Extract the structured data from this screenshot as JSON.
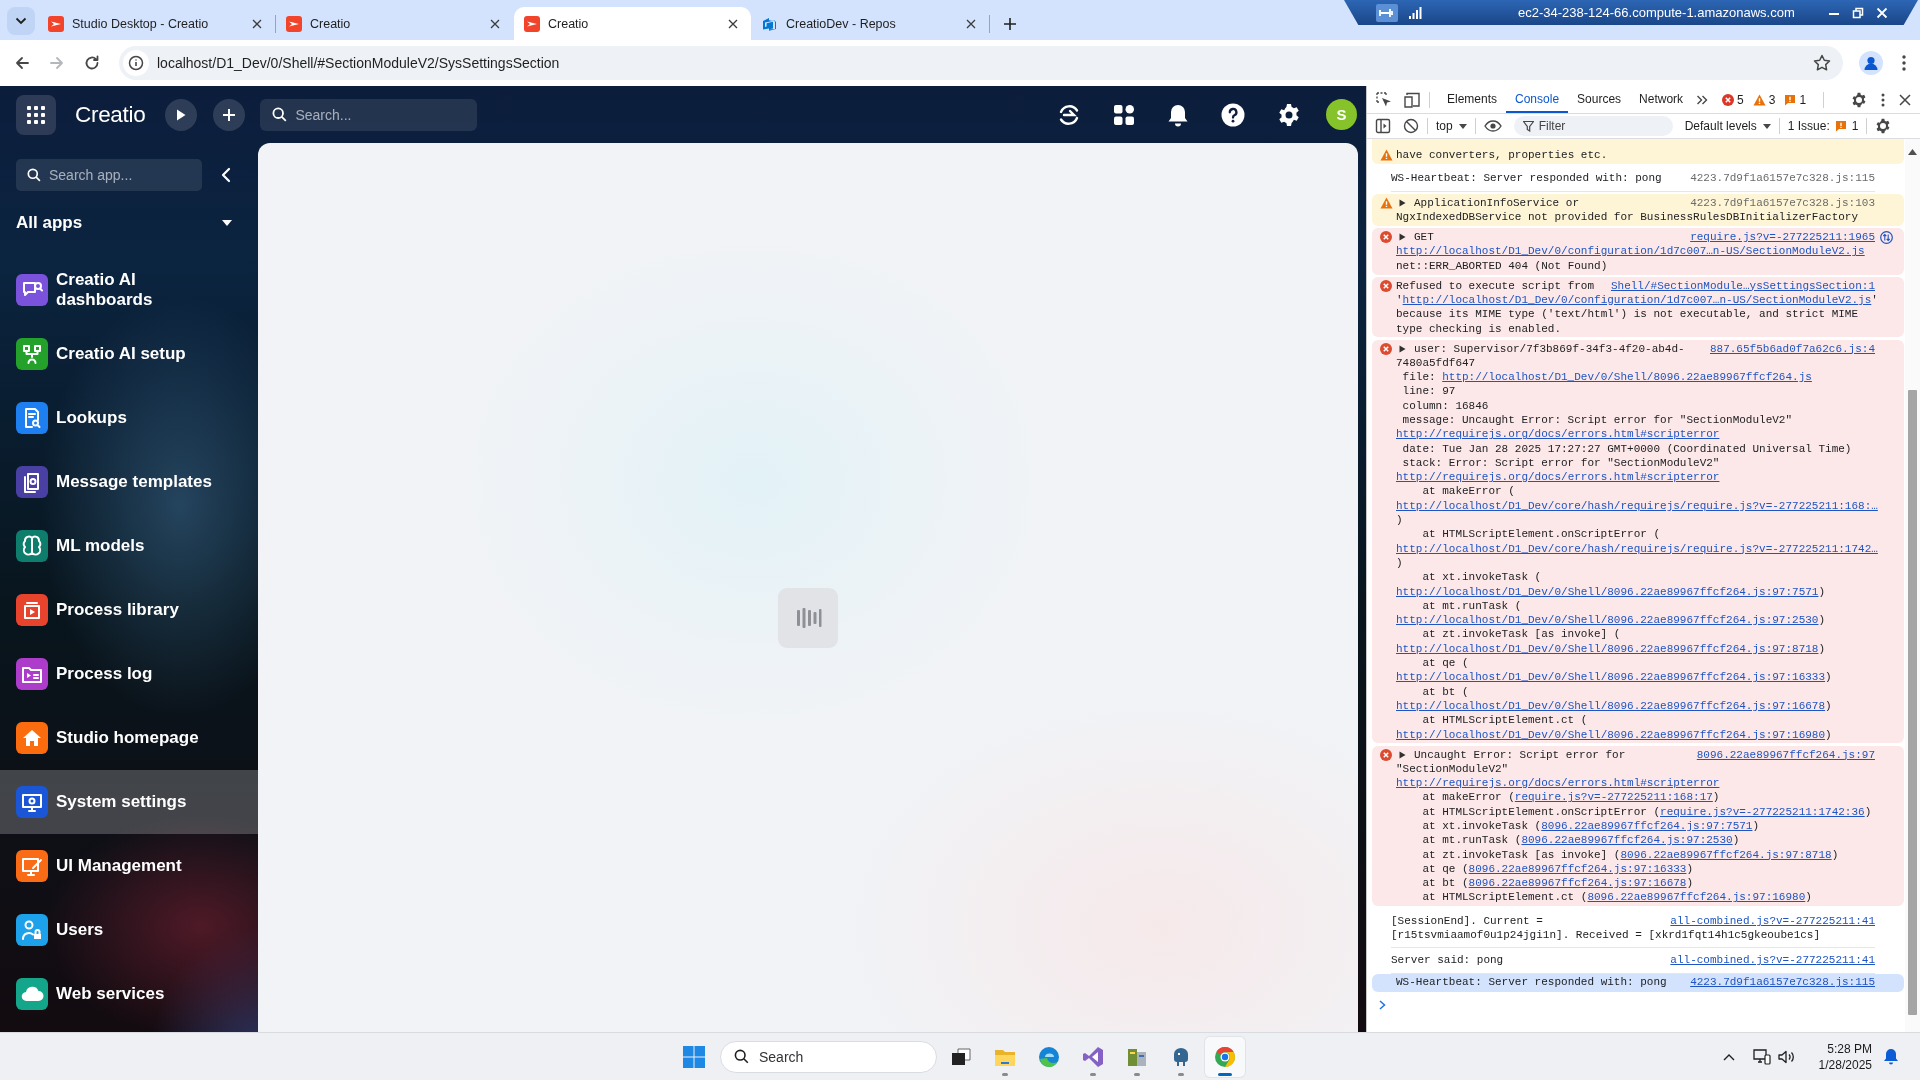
{
  "browser": {
    "tabs": [
      {
        "title": "Studio Desktop - Creatio",
        "kind": "creatio",
        "selected": false
      },
      {
        "title": "Creatio",
        "kind": "creatio",
        "selected": false
      },
      {
        "title": "Creatio",
        "kind": "creatio",
        "selected": true
      },
      {
        "title": "CreatioDev - Repos",
        "kind": "devops",
        "selected": false
      }
    ],
    "nav_buttons": [
      {
        "kind": "back",
        "disabled": false
      },
      {
        "kind": "forward",
        "disabled": true
      },
      {
        "kind": "reload",
        "disabled": false
      }
    ],
    "url": "localhost/D1_Dev/0/Shell/#SectionModuleV2/SysSettingsSection"
  },
  "remote_session": {
    "title": "ec2-34-238-124-66.compute-1.amazonaws.com"
  },
  "creatio": {
    "header": {
      "logo": "Creatio",
      "search_placeholder": "Search...",
      "avatar_initial": "S"
    },
    "sidebar": {
      "search_placeholder": "Search app...",
      "group": "All apps",
      "items": [
        {
          "label": "Creatio AI dashboards",
          "color": "#7b52db",
          "selected": false
        },
        {
          "label": "Creatio AI setup",
          "color": "#24a12a",
          "selected": false
        },
        {
          "label": "Lookups",
          "color": "#1d7ff0",
          "selected": false
        },
        {
          "label": "Message templates",
          "color": "#4a3fa3",
          "selected": false
        },
        {
          "label": "ML models",
          "color": "#0f7d6c",
          "selected": false
        },
        {
          "label": "Process library",
          "color": "#e8432d",
          "selected": false
        },
        {
          "label": "Process log",
          "color": "#ad3ccb",
          "selected": false
        },
        {
          "label": "Studio homepage",
          "color": "#fb6c0e",
          "selected": false
        },
        {
          "label": "System settings",
          "color": "#1a56d6",
          "selected": true
        },
        {
          "label": "UI Management",
          "color": "#f96b14",
          "selected": false
        },
        {
          "label": "Users",
          "color": "#1da1ea",
          "selected": false
        },
        {
          "label": "Web services",
          "color": "#14a68a",
          "selected": false
        }
      ]
    }
  },
  "devtools": {
    "tabs": [
      {
        "label": "Elements",
        "selected": false
      },
      {
        "label": "Console",
        "selected": true
      },
      {
        "label": "Sources",
        "selected": false
      },
      {
        "label": "Network",
        "selected": false
      }
    ],
    "counts": [
      {
        "kind": "error",
        "text": "5"
      },
      {
        "kind": "warning",
        "text": "3"
      },
      {
        "kind": "issue",
        "text": "1"
      }
    ],
    "context": "top",
    "filter_placeholder": "Filter",
    "levels": "Default levels",
    "issues": {
      "label": "1 Issue:",
      "count": "1"
    },
    "messages": [
      {
        "kind": "warning",
        "selected": false,
        "lines": [
          {
            "kind": "plain",
            "segments": [
              {
                "text": "have converters, properties etc.",
                "link": false
              }
            ]
          }
        ]
      },
      {
        "kind": "info",
        "selected": false,
        "source": {
          "text": "4223.7d9f1a6157e7c328.js:115",
          "link": false
        },
        "lines": [
          {
            "kind": "plain",
            "segments": [
              {
                "text": "WS-Heartbeat: Server responded with: pong",
                "link": false
              }
            ]
          }
        ]
      },
      {
        "kind": "warning",
        "selected": false,
        "expanded": false,
        "source": {
          "text": "4223.7d9f1a6157e7c328.js:103",
          "link": false
        },
        "lines": [
          {
            "kind": "plain",
            "segments": [
              {
                "text": "ApplicationInfoService or",
                "link": false
              }
            ]
          },
          {
            "kind": "plain",
            "segments": [
              {
                "text": "NgxIndexedDBService not provided for BusinessRulesDBInitializerFactory",
                "link": false
              }
            ]
          }
        ]
      },
      {
        "kind": "error",
        "selected": false,
        "expanded": false,
        "network_request": true,
        "source": {
          "text": "require.js?v=-277225211:1965",
          "link": true
        },
        "lines": [
          {
            "kind": "plain",
            "segments": [
              {
                "text": "GET",
                "link": false
              }
            ]
          },
          {
            "kind": "plain",
            "segments": [
              {
                "text": "http://localhost/D1_Dev/0/configuration/1d7c007…n-US/SectionModuleV2.js",
                "link": true
              }
            ]
          },
          {
            "kind": "plain",
            "segments": [
              {
                "text": "net::ERR_ABORTED 404 (Not Found)",
                "link": false
              }
            ]
          }
        ]
      },
      {
        "kind": "error",
        "selected": false,
        "source": {
          "text": "Shell/#SectionModule…ysSettingsSection:1",
          "link": true
        },
        "lines": [
          {
            "kind": "plain",
            "segments": [
              {
                "text": "Refused to execute script from",
                "link": false
              }
            ]
          },
          {
            "kind": "plain",
            "segments": [
              {
                "text": "'",
                "link": false
              },
              {
                "text": "http://localhost/D1_Dev/0/configuration/1d7c007…n-US/SectionModuleV2.js",
                "link": true
              },
              {
                "text": "'",
                "link": false
              }
            ]
          },
          {
            "kind": "plain",
            "segments": [
              {
                "text": "because its MIME type ('text/html') is not executable, and strict MIME",
                "link": false
              }
            ]
          },
          {
            "kind": "plain",
            "segments": [
              {
                "text": "type checking is enabled.",
                "link": false
              }
            ]
          }
        ]
      },
      {
        "kind": "error",
        "selected": false,
        "expanded": false,
        "source": {
          "text": "887.65f5b6ad0f7a62c6.js:4",
          "link": true
        },
        "lines": [
          {
            "kind": "plain",
            "segments": [
              {
                "text": "user: Supervisor/7f3b869f-34f3-4f20-ab4d-",
                "link": false
              }
            ]
          },
          {
            "kind": "plain",
            "segments": [
              {
                "text": "7480a5fdf647",
                "link": false
              }
            ]
          },
          {
            "kind": "prop",
            "segments": [
              {
                "text": "file: ",
                "link": false
              },
              {
                "text": "http://localhost/D1_Dev/0/Shell/8096.22ae89967ffcf264.js",
                "link": true
              }
            ]
          },
          {
            "kind": "prop",
            "segments": [
              {
                "text": "line: 97",
                "link": false
              }
            ]
          },
          {
            "kind": "prop",
            "segments": [
              {
                "text": "column: 16846",
                "link": false
              }
            ]
          },
          {
            "kind": "prop",
            "segments": [
              {
                "text": "message: Uncaught Error: Script error for \"SectionModuleV2\"",
                "link": false
              }
            ]
          },
          {
            "kind": "plain",
            "segments": [
              {
                "text": "http://requirejs.org/docs/errors.html#scripterror",
                "link": true
              }
            ]
          },
          {
            "kind": "prop",
            "segments": [
              {
                "text": "date: Tue Jan 28 2025 17:27:27 GMT+0000 (Coordinated Universal Time)",
                "link": false
              }
            ]
          },
          {
            "kind": "prop",
            "segments": [
              {
                "text": "stack: Error: Script error for \"SectionModuleV2\"",
                "link": false
              }
            ]
          },
          {
            "kind": "plain",
            "segments": [
              {
                "text": "http://requirejs.org/docs/errors.html#scripterror",
                "link": true
              }
            ]
          },
          {
            "kind": "stack",
            "segments": [
              {
                "text": "at makeError (",
                "link": false
              }
            ]
          },
          {
            "kind": "plain",
            "segments": [
              {
                "text": "http://localhost/D1_Dev/core/hash/requirejs/require.js?v=-277225211:168:…",
                "link": true
              }
            ]
          },
          {
            "kind": "plain",
            "segments": [
              {
                "text": ")",
                "link": false
              }
            ]
          },
          {
            "kind": "stack",
            "segments": [
              {
                "text": "at HTMLScriptElement.onScriptError (",
                "link": false
              }
            ]
          },
          {
            "kind": "plain",
            "segments": [
              {
                "text": "http://localhost/D1_Dev/core/hash/requirejs/require.js?v=-277225211:1742…",
                "link": true
              }
            ]
          },
          {
            "kind": "plain",
            "segments": [
              {
                "text": ")",
                "link": false
              }
            ]
          },
          {
            "kind": "stack",
            "segments": [
              {
                "text": "at xt.invokeTask (",
                "link": false
              }
            ]
          },
          {
            "kind": "plain",
            "segments": [
              {
                "text": "http://localhost/D1_Dev/0/Shell/8096.22ae89967ffcf264.js:97:7571",
                "link": true
              },
              {
                "text": ")",
                "link": false
              }
            ]
          },
          {
            "kind": "stack",
            "segments": [
              {
                "text": "at mt.runTask (",
                "link": false
              }
            ]
          },
          {
            "kind": "plain",
            "segments": [
              {
                "text": "http://localhost/D1_Dev/0/Shell/8096.22ae89967ffcf264.js:97:2530",
                "link": true
              },
              {
                "text": ")",
                "link": false
              }
            ]
          },
          {
            "kind": "stack",
            "segments": [
              {
                "text": "at zt.invokeTask [as invoke] (",
                "link": false
              }
            ]
          },
          {
            "kind": "plain",
            "segments": [
              {
                "text": "http://localhost/D1_Dev/0/Shell/8096.22ae89967ffcf264.js:97:8718",
                "link": true
              },
              {
                "text": ")",
                "link": false
              }
            ]
          },
          {
            "kind": "stack",
            "segments": [
              {
                "text": "at qe (",
                "link": false
              }
            ]
          },
          {
            "kind": "plain",
            "segments": [
              {
                "text": "http://localhost/D1_Dev/0/Shell/8096.22ae89967ffcf264.js:97:16333",
                "link": true
              },
              {
                "text": ")",
                "link": false
              }
            ]
          },
          {
            "kind": "stack",
            "segments": [
              {
                "text": "at bt (",
                "link": false
              }
            ]
          },
          {
            "kind": "plain",
            "segments": [
              {
                "text": "http://localhost/D1_Dev/0/Shell/8096.22ae89967ffcf264.js:97:16678",
                "link": true
              },
              {
                "text": ")",
                "link": false
              }
            ]
          },
          {
            "kind": "stack",
            "segments": [
              {
                "text": "at HTMLScriptElement.ct (",
                "link": false
              }
            ]
          },
          {
            "kind": "plain",
            "segments": [
              {
                "text": "http://localhost/D1_Dev/0/Shell/8096.22ae89967ffcf264.js:97:16980",
                "link": true
              },
              {
                "text": ")",
                "link": false
              }
            ]
          }
        ]
      },
      {
        "kind": "error",
        "selected": false,
        "expanded": false,
        "source": {
          "text": "8096.22ae89967ffcf264.js:97",
          "link": true
        },
        "lines": [
          {
            "kind": "plain",
            "segments": [
              {
                "text": "Uncaught Error: Script error for",
                "link": false
              }
            ]
          },
          {
            "kind": "plain",
            "segments": [
              {
                "text": "\"SectionModuleV2\"",
                "link": false
              }
            ]
          },
          {
            "kind": "plain",
            "segments": [
              {
                "text": "http://requirejs.org/docs/errors.html#scripterror",
                "link": true
              }
            ]
          },
          {
            "kind": "stack",
            "segments": [
              {
                "text": "at makeError (",
                "link": false
              },
              {
                "text": "require.js?v=-277225211:168:17",
                "link": true
              },
              {
                "text": ")",
                "link": false
              }
            ]
          },
          {
            "kind": "stack",
            "segments": [
              {
                "text": "at HTMLScriptElement.onScriptError (",
                "link": false
              },
              {
                "text": "require.js?v=-277225211:1742:36",
                "link": true
              },
              {
                "text": ")",
                "link": false
              }
            ]
          },
          {
            "kind": "stack",
            "segments": [
              {
                "text": "at xt.invokeTask (",
                "link": false
              },
              {
                "text": "8096.22ae89967ffcf264.js:97:7571",
                "link": true
              },
              {
                "text": ")",
                "link": false
              }
            ]
          },
          {
            "kind": "stack",
            "segments": [
              {
                "text": "at mt.runTask (",
                "link": false
              },
              {
                "text": "8096.22ae89967ffcf264.js:97:2530",
                "link": true
              },
              {
                "text": ")",
                "link": false
              }
            ]
          },
          {
            "kind": "stack",
            "segments": [
              {
                "text": "at zt.invokeTask [as invoke] (",
                "link": false
              },
              {
                "text": "8096.22ae89967ffcf264.js:97:8718",
                "link": true
              },
              {
                "text": ")",
                "link": false
              }
            ]
          },
          {
            "kind": "stack",
            "segments": [
              {
                "text": "at qe (",
                "link": false
              },
              {
                "text": "8096.22ae89967ffcf264.js:97:16333",
                "link": true
              },
              {
                "text": ")",
                "link": false
              }
            ]
          },
          {
            "kind": "stack",
            "segments": [
              {
                "text": "at bt (",
                "link": false
              },
              {
                "text": "8096.22ae89967ffcf264.js:97:16678",
                "link": true
              },
              {
                "text": ")",
                "link": false
              }
            ]
          },
          {
            "kind": "stack",
            "segments": [
              {
                "text": "at HTMLScriptElement.ct (",
                "link": false
              },
              {
                "text": "8096.22ae89967ffcf264.js:97:16980",
                "link": true
              },
              {
                "text": ")",
                "link": false
              }
            ]
          }
        ]
      },
      {
        "kind": "info",
        "selected": false,
        "source": {
          "text": "all-combined.js?v=-277225211:41",
          "link": true
        },
        "lines": [
          {
            "kind": "plain",
            "segments": [
              {
                "text": "[SessionEnd]. Current =",
                "link": false
              }
            ]
          },
          {
            "kind": "plain",
            "segments": [
              {
                "text": "[r15tsvmiaamof0u1p24jgi1n]. Received = [xkrd1fqt14h1c5gkeoube1cs]",
                "link": false
              }
            ]
          }
        ]
      },
      {
        "kind": "info",
        "selected": false,
        "source": {
          "text": "all-combined.js?v=-277225211:41",
          "link": true
        },
        "lines": [
          {
            "kind": "plain",
            "segments": [
              {
                "text": "Server said: pong",
                "link": false
              }
            ]
          }
        ]
      },
      {
        "kind": "info",
        "selected": true,
        "source": {
          "text": "4223.7d9f1a6157e7c328.js:115",
          "link": true
        },
        "lines": [
          {
            "kind": "plain",
            "segments": [
              {
                "text": "WS-Heartbeat: Server responded with: pong",
                "link": false
              }
            ]
          }
        ]
      }
    ]
  },
  "taskbar": {
    "search_placeholder": "Search",
    "apps": [
      {
        "running": false,
        "active": false
      },
      {
        "running": true,
        "active": false
      },
      {
        "running": false,
        "active": false
      },
      {
        "running": true,
        "active": false
      },
      {
        "running": true,
        "active": false
      },
      {
        "running": true,
        "active": false
      },
      {
        "running": true,
        "active": true
      }
    ],
    "clock": {
      "time": "5:28 PM",
      "date": "1/28/2025"
    }
  }
}
